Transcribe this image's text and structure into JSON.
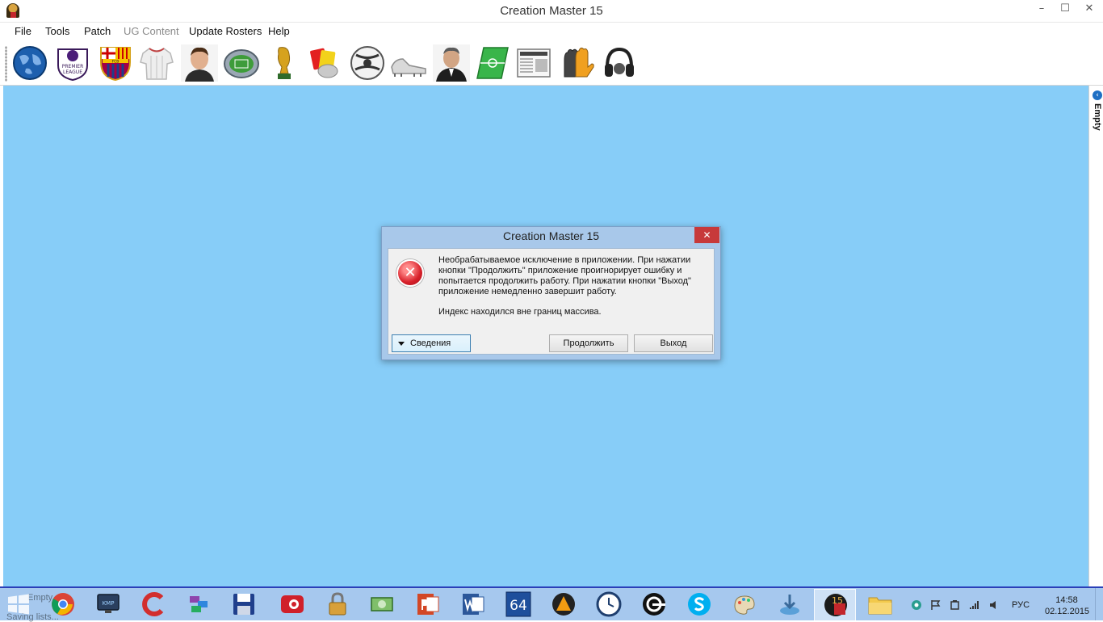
{
  "window": {
    "title": "Creation Master 15",
    "controls": {
      "minimize": "–",
      "maximize": "☐",
      "close": "✕"
    }
  },
  "menu": {
    "items": [
      {
        "label": "File",
        "enabled": true
      },
      {
        "label": "Tools",
        "enabled": true
      },
      {
        "label": "Patch",
        "enabled": true
      },
      {
        "label": "UG Content",
        "enabled": false
      },
      {
        "label": "Update Rosters",
        "enabled": true
      },
      {
        "label": "Help",
        "enabled": true
      }
    ]
  },
  "toolbar": {
    "buttons": [
      "globe-icon",
      "premier-league-badge-icon",
      "fc-barcelona-crest-icon",
      "football-shirt-icon",
      "player-portrait-icon",
      "stadium-icon",
      "world-cup-trophy-icon",
      "referee-cards-whistle-icon",
      "football-ball-icon",
      "football-boots-icon",
      "manager-portrait-icon",
      "pitch-icon",
      "newspaper-icon",
      "goalkeeper-gloves-icon",
      "headphones-icon"
    ],
    "premier_league_text": "PREMIER LEAGUE",
    "fcb_text": "FCB"
  },
  "right_panel": {
    "label": "Empty"
  },
  "dialog": {
    "title": "Creation Master 15",
    "close": "✕",
    "icon": "error-icon",
    "message": "Необрабатываемое исключение в приложении. При нажатии кнопки \"Продолжить\" приложение проигнорирует ошибку и попытается продолжить работу. При нажатии кнопки \"Выход\" приложение немедленно завершит работу.",
    "detail": "Индекс находился вне границ массива.",
    "buttons": {
      "details": "Сведения",
      "continue": "Продолжить",
      "exit": "Выход"
    }
  },
  "taskbar": {
    "ghost_lines": [
      "Empty",
      "Saving lists..."
    ],
    "kmp_label": "KMP",
    "cm_label": "15",
    "apps": [
      "windows-start-icon",
      "chrome-icon",
      "kmplayer-icon",
      "ccleaner-icon",
      "winrar-icon",
      "save-disk-icon",
      "red-app-icon",
      "lock-icon",
      "money-icon",
      "powerpoint-icon",
      "word-icon",
      "aida64-icon",
      "vlc-like-icon",
      "clock-app-icon",
      "steam-like-icon",
      "skype-icon",
      "paint-icon",
      "installer-icon",
      "creation-master-icon",
      "file-explorer-icon"
    ],
    "aida_label": "64",
    "tray": [
      "network-tray-icon",
      "flag-tray-icon",
      "battery-tray-icon",
      "signal-tray-icon",
      "volume-tray-icon"
    ],
    "language": "РУС",
    "time": "14:58",
    "date": "02.12.2015"
  }
}
